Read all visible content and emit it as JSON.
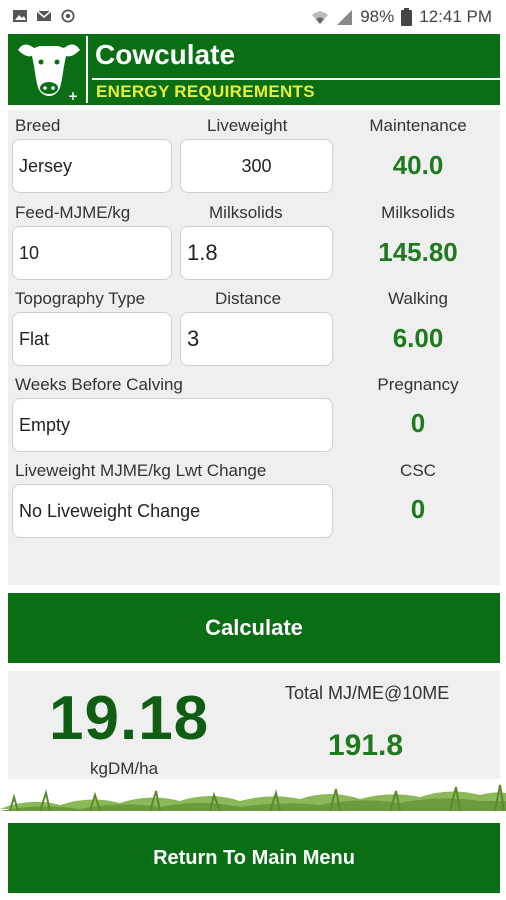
{
  "status_bar": {
    "battery": "98%",
    "time": "12:41 PM",
    "icons": [
      "image-icon",
      "mail-icon",
      "sync-icon",
      "wifi-icon",
      "signal-icon",
      "battery-icon"
    ]
  },
  "header": {
    "title": "Cowculate",
    "subtitle": "ENERGY REQUIREMENTS",
    "logo_icon": "cow-head-icon"
  },
  "form": {
    "breed": {
      "label": "Breed",
      "value": "Jersey"
    },
    "liveweight": {
      "label": "Liveweight",
      "value": "300"
    },
    "feed": {
      "label": "Feed-MJME/kg",
      "value": "10"
    },
    "milksolids": {
      "label": "Milksolids",
      "value": "1.8"
    },
    "topography": {
      "label": "Topography Type",
      "value": "Flat"
    },
    "distance": {
      "label": "Distance",
      "value": "3"
    },
    "weeks_before_calving": {
      "label": "Weeks Before Calving",
      "value": "Empty"
    },
    "lwt_change": {
      "label": "Liveweight MJME/kg Lwt Change",
      "value": "No Liveweight Change"
    }
  },
  "outputs": {
    "maintenance": {
      "label": "Maintenance",
      "value": "40.0"
    },
    "milksolids": {
      "label": "Milksolids",
      "value": "145.80"
    },
    "walking": {
      "label": "Walking",
      "value": "6.00"
    },
    "pregnancy": {
      "label": "Pregnancy",
      "value": "0"
    },
    "csc": {
      "label": "CSC",
      "value": "0"
    }
  },
  "calculate_label": "Calculate",
  "results": {
    "kgdm_value": "19.18",
    "kgdm_unit": "kgDM/ha",
    "total_label": "Total MJ/ME@10ME",
    "total_value": "191.8"
  },
  "return_label": "Return To Main Menu",
  "colors": {
    "primary_green": "#0a6e14",
    "value_green": "#1f7a1f",
    "subtitle_yellow": "#e9ec38",
    "panel_gray": "#efefef"
  }
}
